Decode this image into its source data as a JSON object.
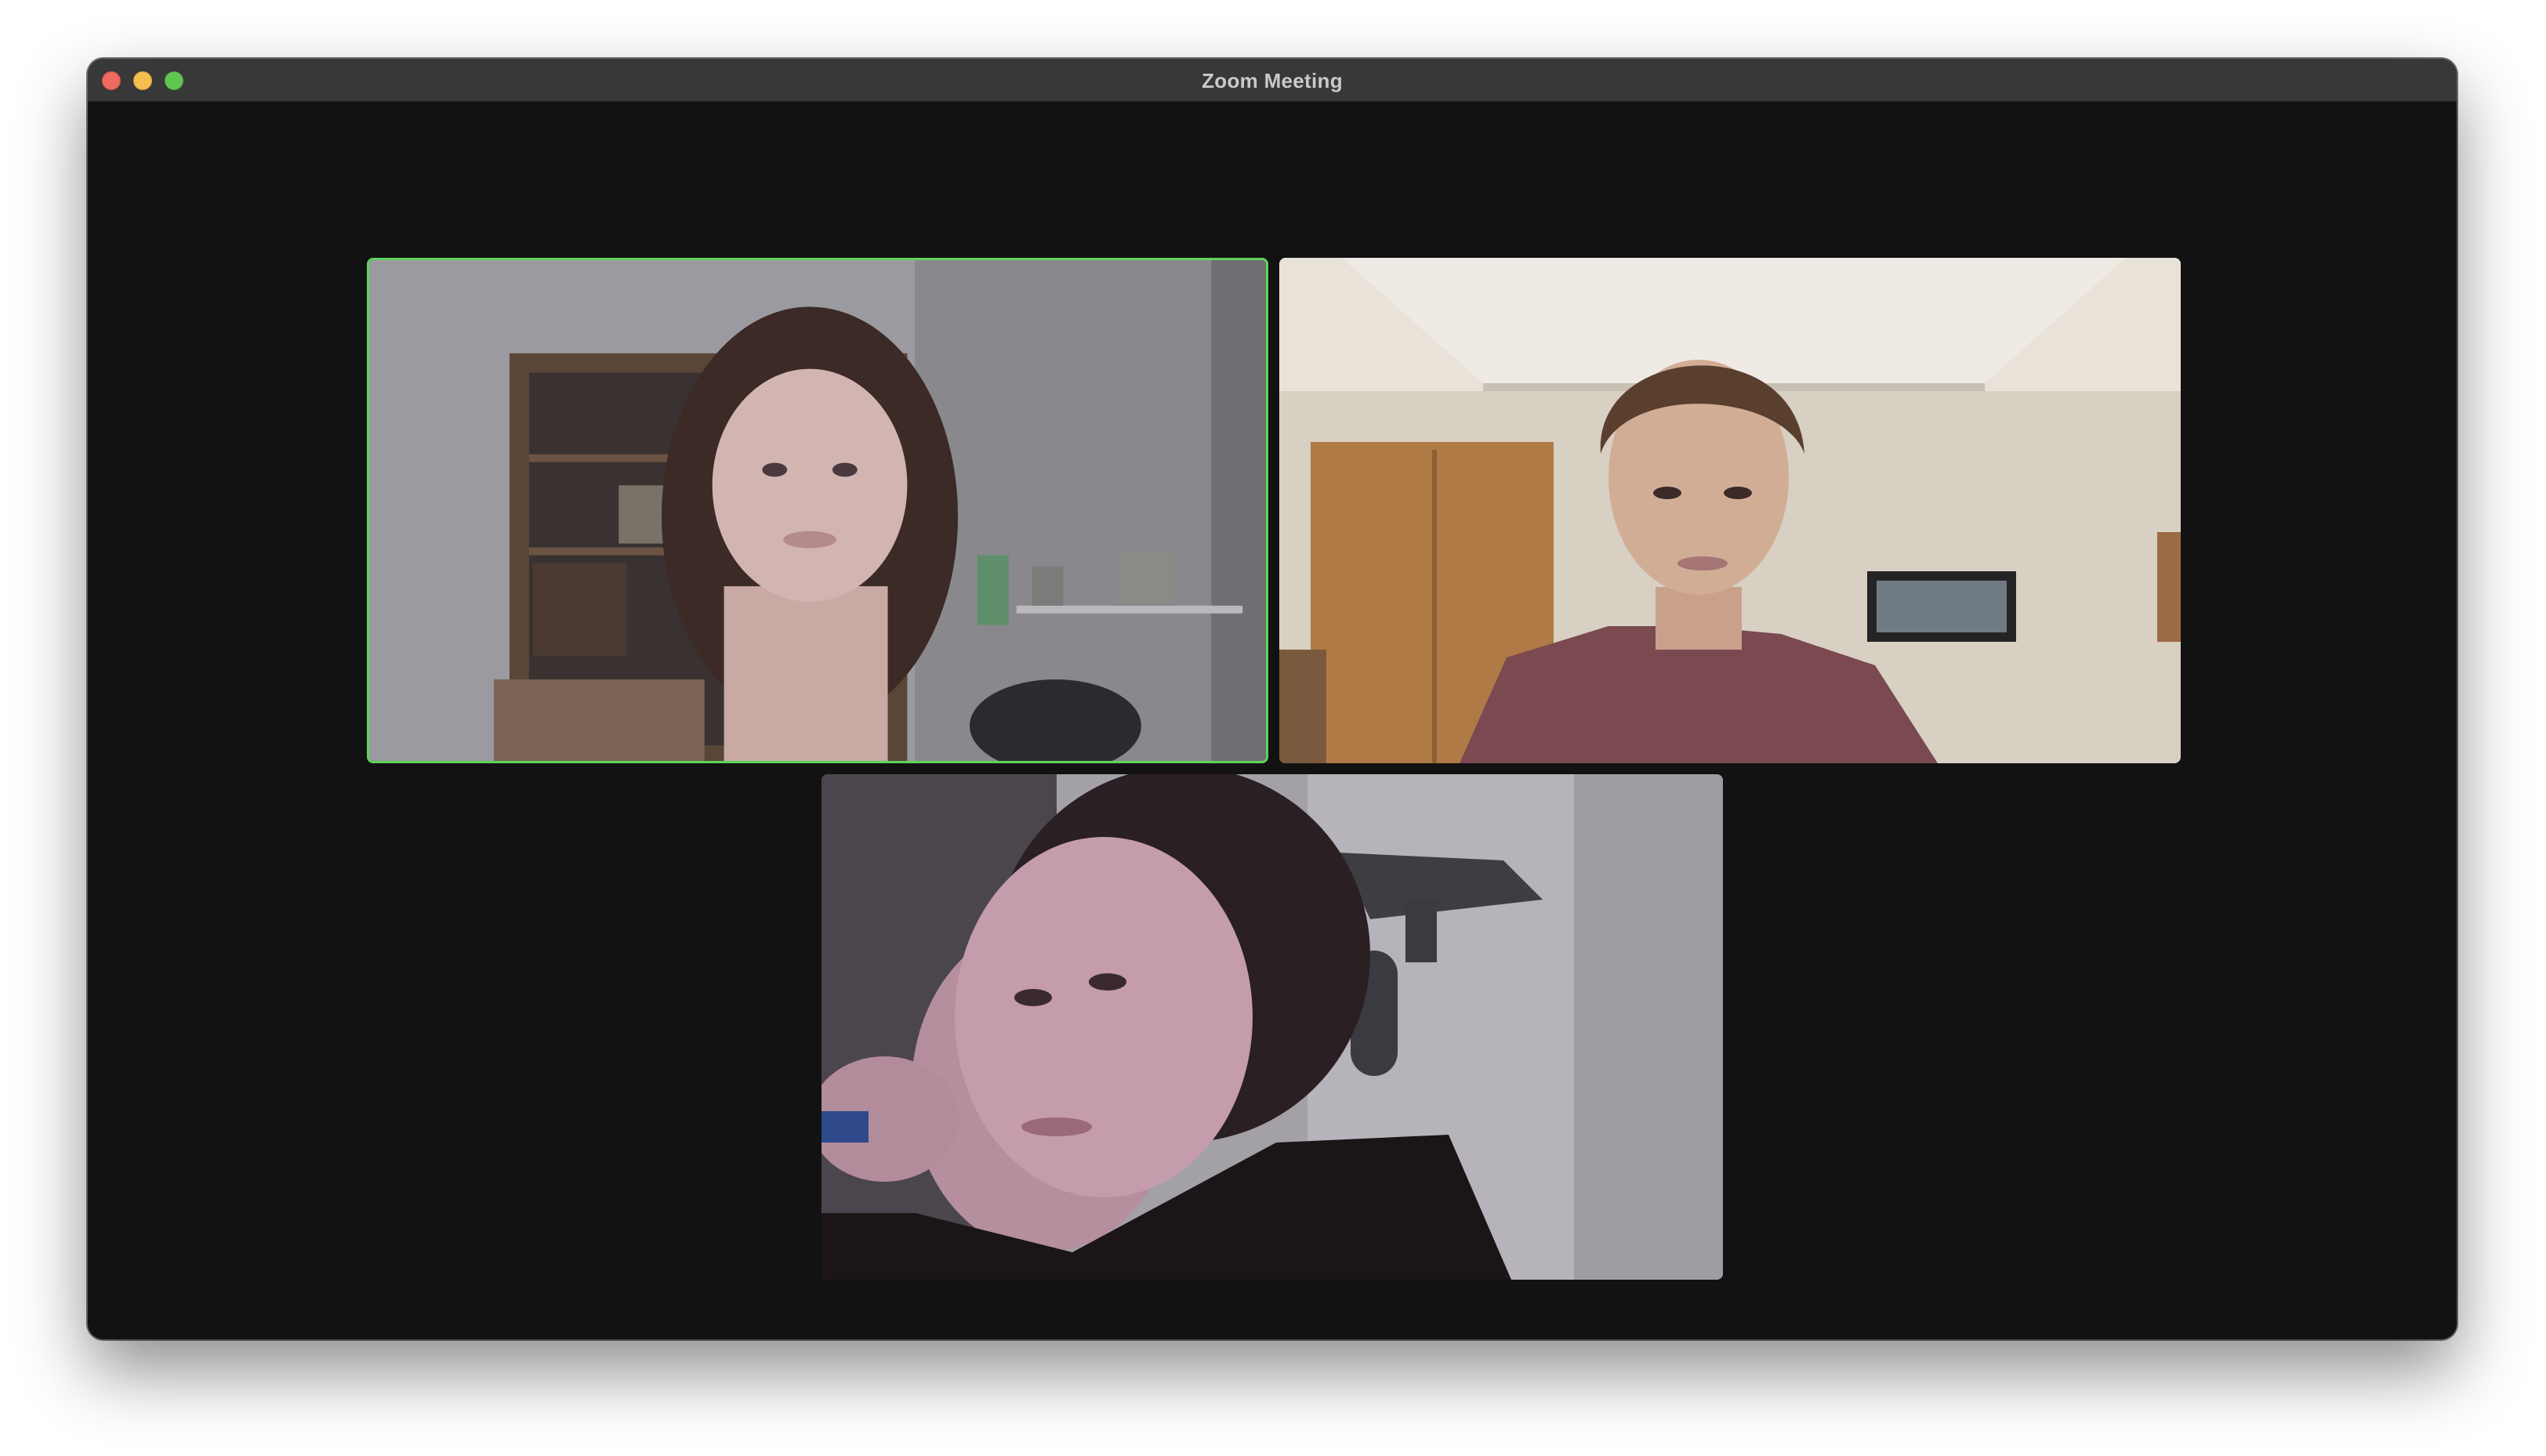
{
  "window": {
    "title": "Zoom Meeting",
    "controls": [
      "close",
      "minimize",
      "zoom"
    ]
  },
  "meeting": {
    "layout": "gallery",
    "participant_count": 3,
    "participants": [
      {
        "tile": "top-left",
        "active_speaker": true,
        "highlight_color": "#5fd35a"
      },
      {
        "tile": "top-right",
        "active_speaker": false
      },
      {
        "tile": "bottom-center",
        "active_speaker": false
      }
    ]
  },
  "colors": {
    "background": "#121212",
    "titlebar": "#383838",
    "active_speaker_border": "#5fd35a"
  }
}
